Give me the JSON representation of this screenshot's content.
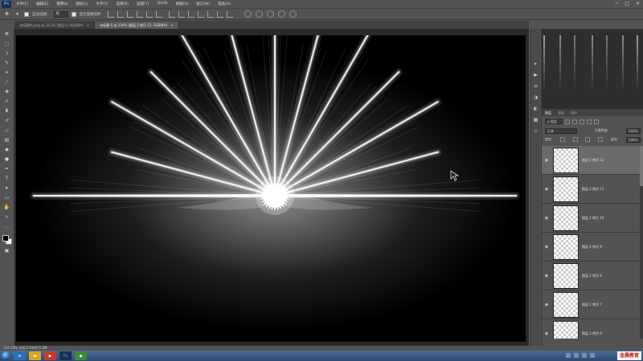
{
  "app": {
    "logo": "Ps"
  },
  "menu": {
    "items": [
      "文件(F)",
      "编辑(E)",
      "图像(I)",
      "图层(L)",
      "文字(Y)",
      "选择(S)",
      "滤镜(T)",
      "3D(D)",
      "视图(V)",
      "窗口(W)",
      "帮助(H)"
    ]
  },
  "window_controls": {
    "minimize": "─",
    "maximize": "□",
    "close": "✕"
  },
  "options": {
    "auto_select_label": "自动选择：",
    "auto_select_value": "组",
    "show_transform_label": "显示变换控件"
  },
  "tabs": [
    {
      "label": "未标题的.jpeg @ 33.3% (图层 0, RGB/8#)",
      "close": "×",
      "active": false
    },
    {
      "label": "未标题-1 @ 104% (图层 2 拷贝 12, RGB/8#)",
      "close": "×",
      "active": true
    }
  ],
  "status": {
    "text": "104.28%  文档:2.93M/71.6M"
  },
  "layers_panel": {
    "tabs": [
      "图层",
      "通道",
      "路径"
    ],
    "filter_label": "ρ 类型",
    "blend_mode": "正常",
    "opacity_label": "不透明度:",
    "opacity_value": "100%",
    "lock_label": "锁定:",
    "fill_label": "填充:",
    "fill_value": "100%",
    "layers": [
      {
        "name": "图层 2 拷贝 12",
        "selected": true
      },
      {
        "name": "图层 2 拷贝 11",
        "selected": false
      },
      {
        "name": "图层 2 拷贝 10",
        "selected": false
      },
      {
        "name": "图层 2 拷贝 9",
        "selected": false
      },
      {
        "name": "图层 2 拷贝 8",
        "selected": false
      },
      {
        "name": "图层 2 拷贝 7",
        "selected": false
      },
      {
        "name": "图层 2 拷贝 6",
        "selected": false
      }
    ]
  },
  "taskbar": {
    "watermark": "金晨教育"
  },
  "colors": {
    "foreground": "#000000",
    "background": "#ffffff"
  }
}
